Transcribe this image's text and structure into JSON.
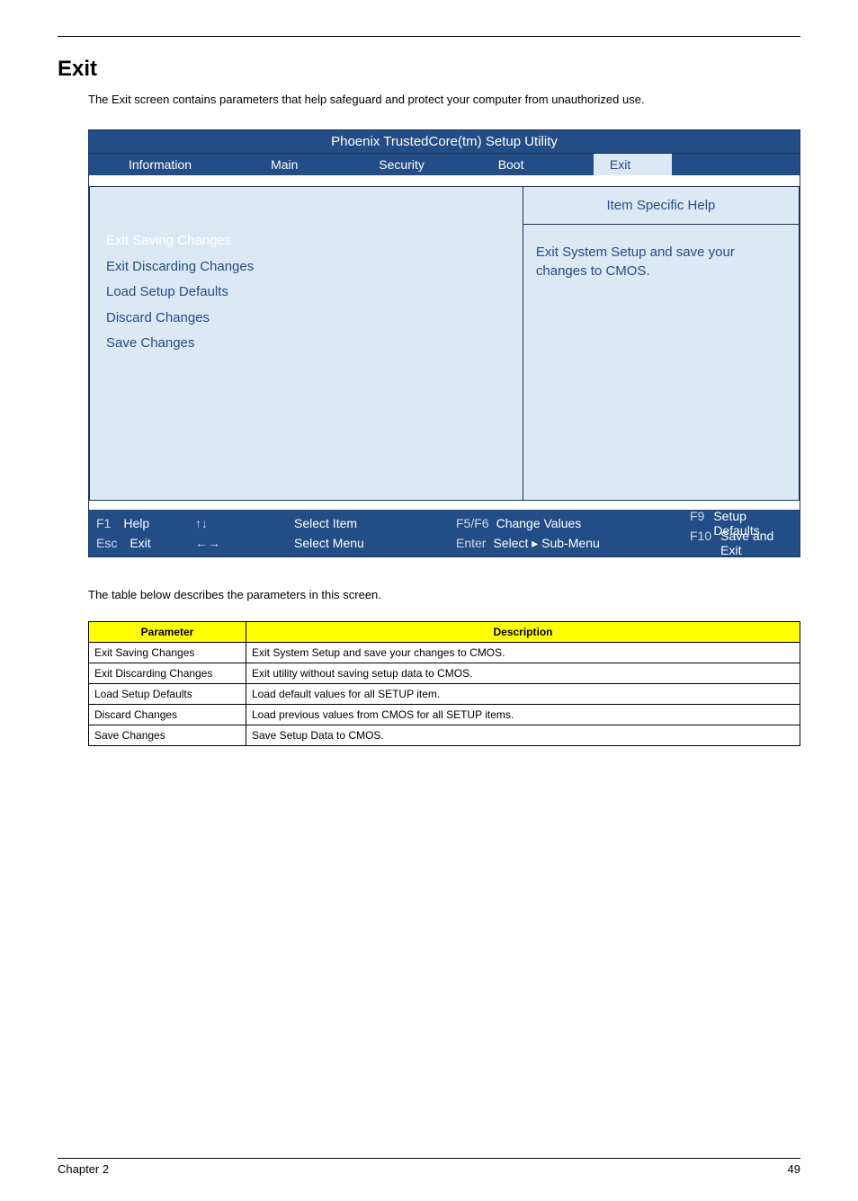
{
  "page": {
    "section_title": "Exit",
    "intro": "The Exit screen contains parameters that help safeguard and protect your computer from unauthorized use.",
    "table_intro": "The table below describes the parameters in this screen.",
    "footer_left": "Chapter 2",
    "footer_right": "49"
  },
  "bios": {
    "title": "Phoenix TrustedCore(tm) Setup Utility",
    "tabs": {
      "information": "Information",
      "main": "Main",
      "security": "Security",
      "boot": "Boot",
      "exit": "Exit"
    },
    "help_header": "Item Specific Help",
    "help_body": "Exit System Setup and save your changes to CMOS.",
    "menu": {
      "exit_saving": "Exit Saving Changes",
      "exit_discarding": "Exit Discarding Changes",
      "load_defaults": "Load Setup Defaults",
      "discard": "Discard Changes",
      "save": "Save Changes"
    },
    "foot": {
      "f1": "F1",
      "help": "Help",
      "updown": "↑↓",
      "select_item": "Select Item",
      "f5f6": "F5/F6",
      "change_values": "Change Values",
      "f9": "F9",
      "setup_defaults": "Setup Defaults",
      "esc": "Esc",
      "exit": "Exit",
      "leftright": "←→",
      "select_menu": "Select Menu",
      "enter": "Enter",
      "select_sub": "Select   ▸  Sub-Menu",
      "f10": "F10",
      "save_exit": "Save and Exit"
    }
  },
  "params": {
    "head_param": "Parameter",
    "head_desc": "Description",
    "rows": [
      {
        "p": "Exit Saving Changes",
        "d": "Exit System Setup and save your changes to CMOS."
      },
      {
        "p": "Exit Discarding Changes",
        "d": "Exit utility without saving setup data to CMOS."
      },
      {
        "p": "Load Setup Defaults",
        "d": "Load default values for all SETUP item."
      },
      {
        "p": "Discard Changes",
        "d": "Load previous values from CMOS for all SETUP items."
      },
      {
        "p": "Save Changes",
        "d": "Save Setup Data to CMOS."
      }
    ]
  }
}
